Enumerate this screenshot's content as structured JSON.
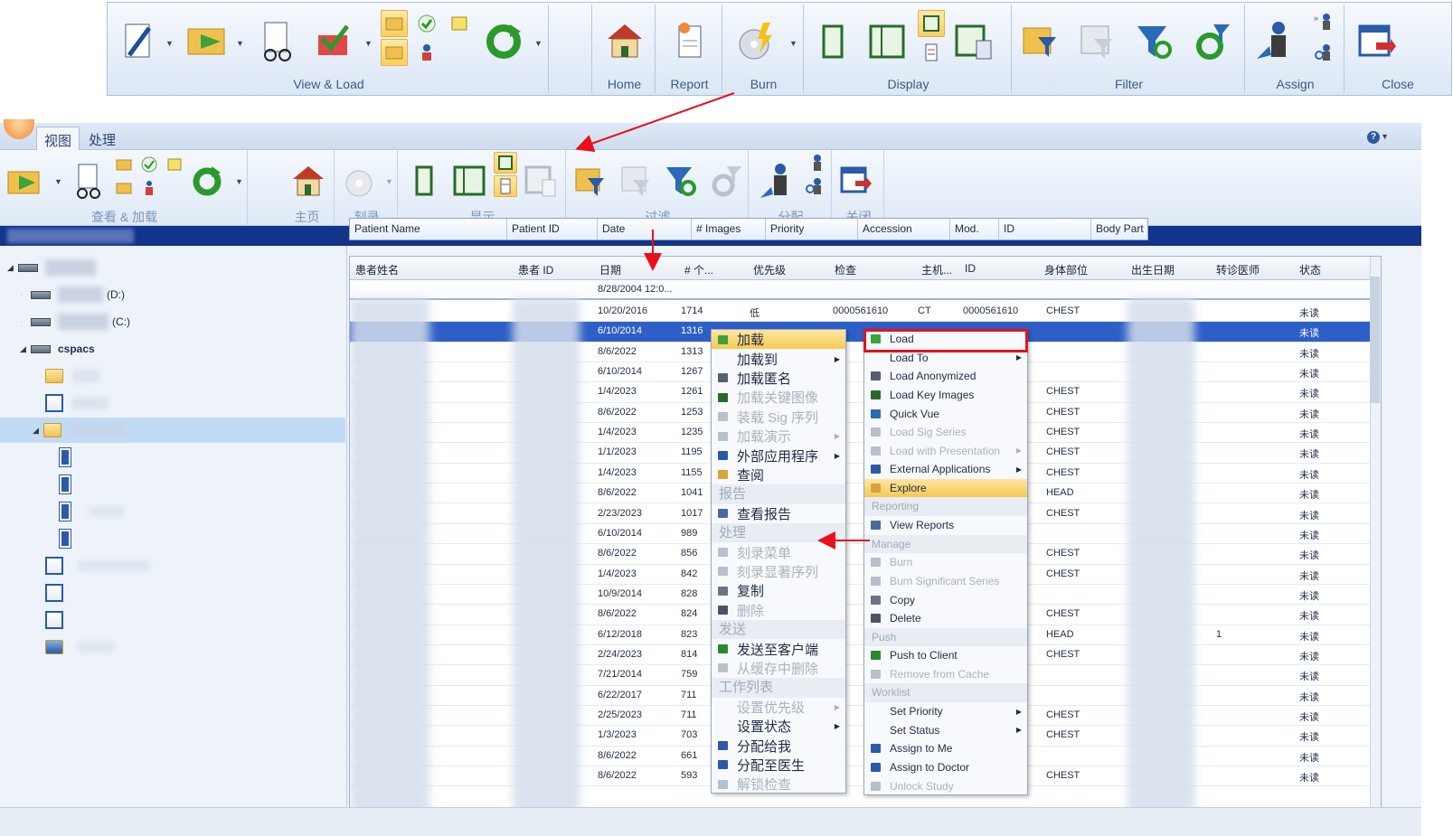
{
  "en_ribbon": {
    "groups": [
      {
        "label": "View & Load"
      },
      {
        "label": "Home"
      },
      {
        "label": "Report"
      },
      {
        "label": "Burn"
      },
      {
        "label": "Display"
      },
      {
        "label": "Filter"
      },
      {
        "label": "Assign"
      },
      {
        "label": "Close"
      }
    ]
  },
  "cn_app": {
    "tabs": [
      {
        "label": "视图"
      },
      {
        "label": "处理"
      }
    ],
    "help": "?",
    "ribbon_groups": [
      {
        "label": "查看 & 加载"
      },
      {
        "label": "主页"
      },
      {
        "label": "刻录"
      },
      {
        "label": "显示"
      },
      {
        "label": "过滤"
      },
      {
        "label": "分配"
      },
      {
        "label": "关闭"
      }
    ]
  },
  "en_header": {
    "columns": [
      "Patient Name",
      "Patient ID",
      "Date",
      "# Images",
      "Priority",
      "Accession",
      "Mod.",
      "ID",
      "Body Part"
    ]
  },
  "tree": {
    "drive_d": "(D:)",
    "drive_c": "(C:)",
    "root": "cspacs"
  },
  "grid": {
    "columns": [
      "患者姓名",
      "患者 ID",
      "日期",
      "# 个...",
      "优先级",
      "检查",
      "主机...",
      "ID",
      "身体部位",
      "出生日期",
      "转诊医师",
      "状态"
    ],
    "filter_date": "8/28/2004 12:0...",
    "rows": [
      {
        "date": "10/20/2016",
        "images": "1714",
        "priority": "低",
        "accession": "0000561610",
        "mod": "CT",
        "id": "0000561610",
        "body": "CHEST",
        "ref": "",
        "status": "未读"
      },
      {
        "date": "6/10/2014",
        "images": "1316",
        "priority": "",
        "accession": "",
        "mod": "",
        "id": "",
        "body": "",
        "ref": "",
        "status": "未读"
      },
      {
        "date": "8/6/2022",
        "images": "1313",
        "priority": "",
        "accession": "",
        "mod": "",
        "id": "",
        "body": "",
        "ref": "",
        "status": "未读"
      },
      {
        "date": "6/10/2014",
        "images": "1267",
        "priority": "",
        "accession": "",
        "mod": "",
        "id": "",
        "body": "",
        "ref": "",
        "status": "未读"
      },
      {
        "date": "1/4/2023",
        "images": "1261",
        "priority": "",
        "accession": "",
        "mod": "",
        "id": "",
        "body": "CHEST",
        "ref": "",
        "status": "未读"
      },
      {
        "date": "8/6/2022",
        "images": "1253",
        "priority": "",
        "accession": "",
        "mod": "",
        "id": "",
        "body": "CHEST",
        "ref": "",
        "status": "未读"
      },
      {
        "date": "1/4/2023",
        "images": "1235",
        "priority": "",
        "accession": "",
        "mod": "",
        "id": "",
        "body": "CHEST",
        "ref": "",
        "status": "未读"
      },
      {
        "date": "1/1/2023",
        "images": "1195",
        "priority": "",
        "accession": "",
        "mod": "",
        "id": "",
        "body": "CHEST",
        "ref": "",
        "status": "未读"
      },
      {
        "date": "1/4/2023",
        "images": "1155",
        "priority": "",
        "accession": "",
        "mod": "",
        "id": "",
        "body": "CHEST",
        "ref": "",
        "status": "未读"
      },
      {
        "date": "8/6/2022",
        "images": "1041",
        "priority": "",
        "accession": "",
        "mod": "",
        "id": "",
        "body": "HEAD",
        "ref": "",
        "status": "未读"
      },
      {
        "date": "2/23/2023",
        "images": "1017",
        "priority": "",
        "accession": "",
        "mod": "",
        "id": "",
        "body": "CHEST",
        "ref": "",
        "status": "未读"
      },
      {
        "date": "6/10/2014",
        "images": "989",
        "priority": "",
        "accession": "",
        "mod": "",
        "id": "",
        "body": "",
        "ref": "",
        "status": "未读"
      },
      {
        "date": "8/6/2022",
        "images": "856",
        "priority": "",
        "accession": "",
        "mod": "",
        "id": "",
        "body": "CHEST",
        "ref": "",
        "status": "未读"
      },
      {
        "date": "1/4/2023",
        "images": "842",
        "priority": "",
        "accession": "",
        "mod": "",
        "id": "",
        "body": "CHEST",
        "ref": "",
        "status": "未读"
      },
      {
        "date": "10/9/2014",
        "images": "828",
        "priority": "",
        "accession": "",
        "mod": "",
        "id": "",
        "body": "",
        "ref": "",
        "status": "未读"
      },
      {
        "date": "8/6/2022",
        "images": "824",
        "priority": "",
        "accession": "",
        "mod": "",
        "id": "",
        "body": "CHEST",
        "ref": "",
        "status": "未读"
      },
      {
        "date": "6/12/2018",
        "images": "823",
        "priority": "",
        "accession": "",
        "mod": "",
        "id": "",
        "body": "HEAD",
        "ref": "1",
        "status": "未读"
      },
      {
        "date": "2/24/2023",
        "images": "814",
        "priority": "",
        "accession": "",
        "mod": "",
        "id": "",
        "body": "CHEST",
        "ref": "",
        "status": "未读"
      },
      {
        "date": "7/21/2014",
        "images": "759",
        "priority": "",
        "accession": "",
        "mod": "",
        "id": "",
        "body": "",
        "ref": "",
        "status": "未读"
      },
      {
        "date": "6/22/2017",
        "images": "711",
        "priority": "",
        "accession": "",
        "mod": "",
        "id": "",
        "body": "",
        "ref": "",
        "status": "未读"
      },
      {
        "date": "2/25/2023",
        "images": "711",
        "priority": "",
        "accession": "",
        "mod": "",
        "id": "",
        "body": "CHEST",
        "ref": "",
        "status": "未读"
      },
      {
        "date": "1/3/2023",
        "images": "703",
        "priority": "",
        "accession": "",
        "mod": "",
        "id": "",
        "body": "CHEST",
        "ref": "",
        "status": "未读"
      },
      {
        "date": "8/6/2022",
        "images": "661",
        "priority": "",
        "accession": "",
        "mod": "",
        "id": "",
        "body": "",
        "ref": "",
        "status": "未读"
      },
      {
        "date": "8/6/2022",
        "images": "593",
        "priority": "",
        "accession": "",
        "mod": "",
        "id": "",
        "body": "CHEST",
        "ref": "",
        "status": "未读"
      }
    ]
  },
  "cn_menu": {
    "items": [
      {
        "label": "加载",
        "kind": "item",
        "icon": "load-icon",
        "highlighted": true
      },
      {
        "label": "加载到",
        "kind": "item",
        "submenu": true
      },
      {
        "label": "加载匿名",
        "kind": "item",
        "icon": "anonymous-icon"
      },
      {
        "label": "加载关键图像",
        "kind": "item",
        "icon": "key-images-icon",
        "disabled": true
      },
      {
        "label": "装载 Sig 序列",
        "kind": "item",
        "icon": "sig-series-icon",
        "disabled": true
      },
      {
        "label": "加载演示",
        "kind": "item",
        "icon": "presentation-icon",
        "disabled": true,
        "submenu": true
      },
      {
        "label": "外部应用程序",
        "kind": "item",
        "icon": "external-apps-icon",
        "submenu": true
      },
      {
        "label": "查阅",
        "kind": "item",
        "icon": "explore-icon"
      },
      {
        "label": "报告",
        "kind": "header"
      },
      {
        "label": "查看报告",
        "kind": "item",
        "icon": "view-reports-icon"
      },
      {
        "label": "处理",
        "kind": "header"
      },
      {
        "label": "刻录菜单",
        "kind": "item",
        "icon": "burn-icon",
        "disabled": true
      },
      {
        "label": "刻录显著序列",
        "kind": "item",
        "icon": "burn-series-icon",
        "disabled": true
      },
      {
        "label": "复制",
        "kind": "item",
        "icon": "copy-icon"
      },
      {
        "label": "删除",
        "kind": "item",
        "icon": "delete-icon",
        "disabled": true
      },
      {
        "label": "发送",
        "kind": "header"
      },
      {
        "label": "发送至客户端",
        "kind": "item",
        "icon": "push-client-icon"
      },
      {
        "label": "从缓存中删除",
        "kind": "item",
        "icon": "remove-cache-icon",
        "disabled": true
      },
      {
        "label": "工作列表",
        "kind": "header"
      },
      {
        "label": "设置优先级",
        "kind": "item",
        "disabled": true,
        "submenu": true
      },
      {
        "label": "设置状态",
        "kind": "item",
        "submenu": true
      },
      {
        "label": "分配给我",
        "kind": "item",
        "icon": "assign-me-icon"
      },
      {
        "label": "分配至医生",
        "kind": "item",
        "icon": "assign-doctor-icon"
      },
      {
        "label": "解锁检查",
        "kind": "item",
        "icon": "unlock-icon",
        "disabled": true
      }
    ]
  },
  "en_menu": {
    "items": [
      {
        "label": "Load",
        "kind": "item",
        "icon": "load-icon"
      },
      {
        "label": "Load To",
        "kind": "item",
        "submenu": true
      },
      {
        "label": "Load Anonymized",
        "kind": "item",
        "icon": "anonymous-icon"
      },
      {
        "label": "Load Key Images",
        "kind": "item",
        "icon": "key-images-icon"
      },
      {
        "label": "Quick Vue",
        "kind": "item",
        "icon": "quick-vue-icon"
      },
      {
        "label": "Load Sig Series",
        "kind": "item",
        "icon": "sig-series-icon",
        "disabled": true
      },
      {
        "label": "Load with Presentation",
        "kind": "item",
        "icon": "presentation-icon",
        "disabled": true,
        "submenu": true
      },
      {
        "label": "External Applications",
        "kind": "item",
        "icon": "external-apps-icon",
        "submenu": true
      },
      {
        "label": "Explore",
        "kind": "item",
        "icon": "explore-icon",
        "highlighted": true
      },
      {
        "label": "Reporting",
        "kind": "header"
      },
      {
        "label": "View Reports",
        "kind": "item",
        "icon": "view-reports-icon"
      },
      {
        "label": "Manage",
        "kind": "header"
      },
      {
        "label": "Burn",
        "kind": "item",
        "icon": "burn-icon",
        "disabled": true
      },
      {
        "label": "Burn Significant Series",
        "kind": "item",
        "icon": "burn-series-icon",
        "disabled": true
      },
      {
        "label": "Copy",
        "kind": "item",
        "icon": "copy-icon"
      },
      {
        "label": "Delete",
        "kind": "item",
        "icon": "delete-icon"
      },
      {
        "label": "Push",
        "kind": "header"
      },
      {
        "label": "Push to Client",
        "kind": "item",
        "icon": "push-client-icon"
      },
      {
        "label": "Remove from Cache",
        "kind": "item",
        "icon": "remove-cache-icon",
        "disabled": true
      },
      {
        "label": "Worklist",
        "kind": "header"
      },
      {
        "label": "Set Priority",
        "kind": "item",
        "submenu": true
      },
      {
        "label": "Set Status",
        "kind": "item",
        "submenu": true
      },
      {
        "label": "Assign to Me",
        "kind": "item",
        "icon": "assign-me-icon"
      },
      {
        "label": "Assign to Doctor",
        "kind": "item",
        "icon": "assign-doctor-icon"
      },
      {
        "label": "Unlock Study",
        "kind": "item",
        "icon": "unlock-icon",
        "disabled": true
      }
    ]
  },
  "colors": {
    "selection": "#2e5fc6",
    "menu_highlight": "#f6c955",
    "annotation_red": "#e8101a",
    "header_band": "#12348a"
  }
}
